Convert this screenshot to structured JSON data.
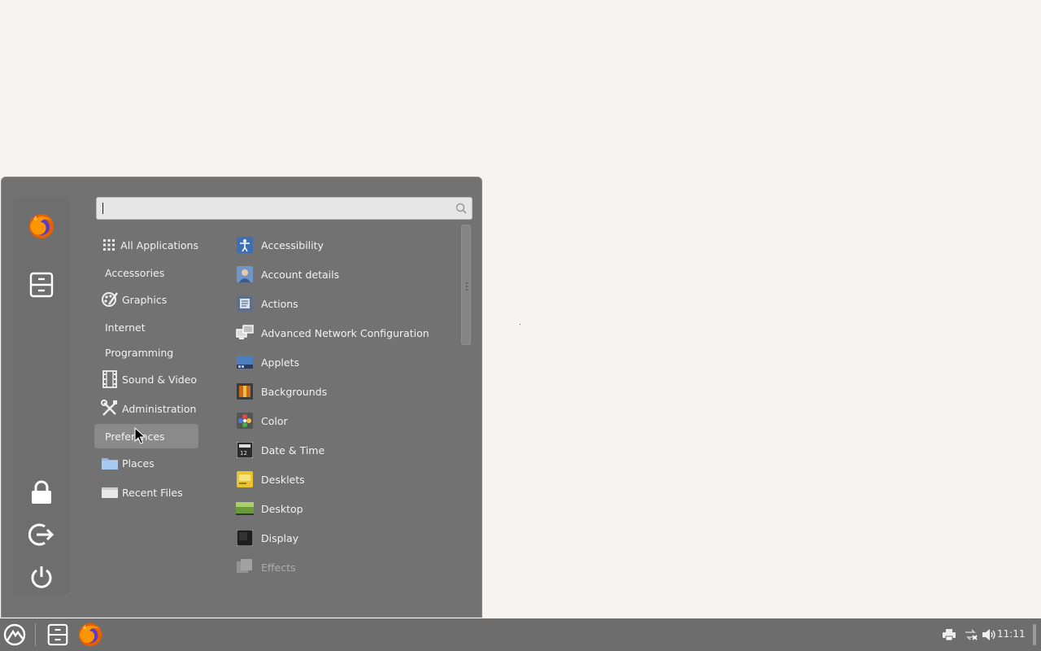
{
  "search": {
    "placeholder": "",
    "value": ""
  },
  "sidebar": {
    "favorites": [
      {
        "name": "firefox-icon"
      },
      {
        "name": "file-manager-icon"
      }
    ],
    "session": [
      {
        "name": "lock-screen-icon"
      },
      {
        "name": "logout-icon"
      },
      {
        "name": "power-icon"
      }
    ]
  },
  "categories": [
    {
      "label": "All Applications",
      "icon": "grid-icon"
    },
    {
      "label": "Accessories",
      "icon": ""
    },
    {
      "label": "Graphics",
      "icon": "graphics-icon"
    },
    {
      "label": "Internet",
      "icon": ""
    },
    {
      "label": "Programming",
      "icon": ""
    },
    {
      "label": "Sound & Video",
      "icon": "film-icon"
    },
    {
      "label": "Administration",
      "icon": "tools-icon"
    },
    {
      "label": "Preferences",
      "icon": "",
      "selected": true
    },
    {
      "label": "Places",
      "icon": "folder-icon"
    },
    {
      "label": "Recent Files",
      "icon": "recent-files-icon"
    }
  ],
  "apps": [
    {
      "label": "Accessibility",
      "icon": "accessibility-icon"
    },
    {
      "label": "Account details",
      "icon": "account-icon"
    },
    {
      "label": "Actions",
      "icon": "actions-icon"
    },
    {
      "label": "Advanced Network Configuration",
      "icon": "network-icon"
    },
    {
      "label": "Applets",
      "icon": "applets-icon"
    },
    {
      "label": "Backgrounds",
      "icon": "backgrounds-icon"
    },
    {
      "label": "Color",
      "icon": "color-icon"
    },
    {
      "label": "Date & Time",
      "icon": "date-time-icon"
    },
    {
      "label": "Desklets",
      "icon": "desklets-icon"
    },
    {
      "label": "Desktop",
      "icon": "desktop-icon"
    },
    {
      "label": "Display",
      "icon": "display-icon"
    },
    {
      "label": "Effects",
      "icon": "effects-icon",
      "faded": true
    }
  ],
  "taskbar": {
    "clock": "11:11"
  },
  "colors": {
    "menu_bg": "#727272",
    "desktop_bg": "#f5f4f2",
    "taskbar_bg": "#6d6d6d",
    "selected": "#8a8a8a"
  }
}
